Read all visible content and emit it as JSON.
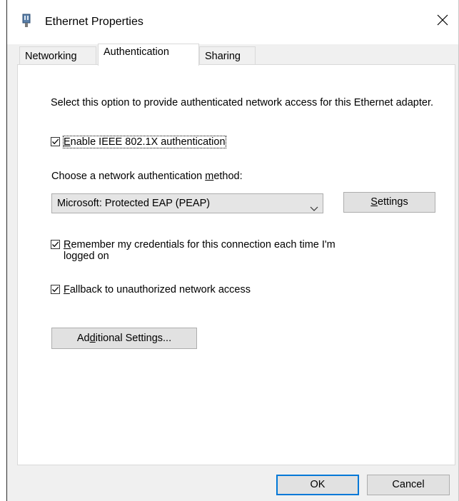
{
  "window": {
    "title": "Ethernet Properties",
    "icon": "network-adapter-icon",
    "close_icon": "close-icon"
  },
  "tabs": [
    {
      "label": "Networking",
      "active": false
    },
    {
      "label": "Authentication",
      "active": true
    },
    {
      "label": "Sharing",
      "active": false
    }
  ],
  "authentication": {
    "description": "Select this option to provide authenticated network access for this Ethernet adapter.",
    "enable_8021x": {
      "label_prefix": "",
      "label_accel": "E",
      "label_rest": "nable IEEE 802.1X authentication",
      "checked": true
    },
    "method_label": "Choose a network authentication method:",
    "method_select": {
      "value": "Microsoft: Protected EAP (PEAP)"
    },
    "settings_button": {
      "label_accel": "S",
      "label_rest": "ettings"
    },
    "remember_credentials": {
      "label_accel": "R",
      "label_rest": "emember my credentials for this connection each time I'm logged on",
      "checked": true
    },
    "fallback": {
      "label_accel": "F",
      "label_rest": "allback to unauthorized network access",
      "checked": true
    },
    "additional_settings_button": {
      "label_prefix": "Ad",
      "label_accel": "d",
      "label_rest": "itional Settings..."
    }
  },
  "footer": {
    "ok_label": "OK",
    "cancel_label": "Cancel"
  }
}
